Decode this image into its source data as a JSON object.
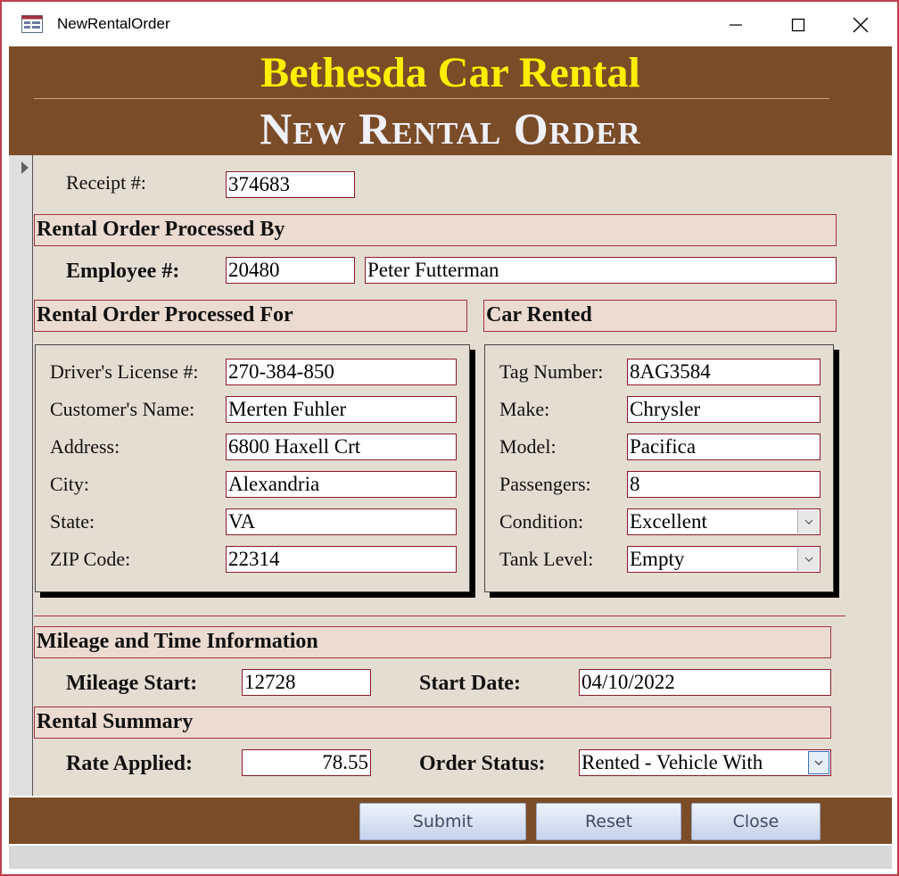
{
  "window": {
    "title": "NewRentalOrder"
  },
  "header": {
    "company": "Bethesda Car Rental",
    "form_title": "New Rental Order"
  },
  "receipt": {
    "label": "Receipt #:",
    "value": "374683"
  },
  "processed_by": {
    "section_title": "Rental Order Processed By",
    "employee_label": "Employee #:",
    "employee_number": "20480",
    "employee_name": "Peter Futterman"
  },
  "processed_for": {
    "section_title": "Rental Order Processed For",
    "fields": [
      {
        "label": "Driver's License #:",
        "value": "270-384-850"
      },
      {
        "label": "Customer's Name:",
        "value": "Merten Fuhler"
      },
      {
        "label": "Address:",
        "value": "6800 Haxell Crt"
      },
      {
        "label": "City:",
        "value": "Alexandria"
      },
      {
        "label": "State:",
        "value": "VA"
      },
      {
        "label": "ZIP Code:",
        "value": "22314"
      }
    ]
  },
  "car_rented": {
    "section_title": "Car Rented",
    "fields": [
      {
        "label": "Tag Number:",
        "value": "8AG3584"
      },
      {
        "label": "Make:",
        "value": "Chrysler"
      },
      {
        "label": "Model:",
        "value": "Pacifica"
      },
      {
        "label": "Passengers:",
        "value": "8"
      },
      {
        "label": "Condition:",
        "value": "Excellent"
      },
      {
        "label": "Tank Level:",
        "value": "Empty"
      }
    ]
  },
  "mileage_time": {
    "section_title": "Mileage and Time Information",
    "mileage_label": "Mileage Start:",
    "mileage_value": "12728",
    "date_label": "Start Date:",
    "date_value": "04/10/2022"
  },
  "summary": {
    "section_title": "Rental Summary",
    "rate_label": "Rate Applied:",
    "rate_value": "78.55",
    "status_label": "Order Status:",
    "status_value": "Rented - Vehicle With"
  },
  "buttons": {
    "submit": "Submit",
    "reset": "Reset",
    "close": "Close"
  },
  "colors": {
    "header_bg": "#7b4c28",
    "company_text": "#ffee00",
    "detail_bg": "#e4ddd2",
    "section_bg": "#ecdbd0",
    "field_border": "#8b1a2a"
  }
}
